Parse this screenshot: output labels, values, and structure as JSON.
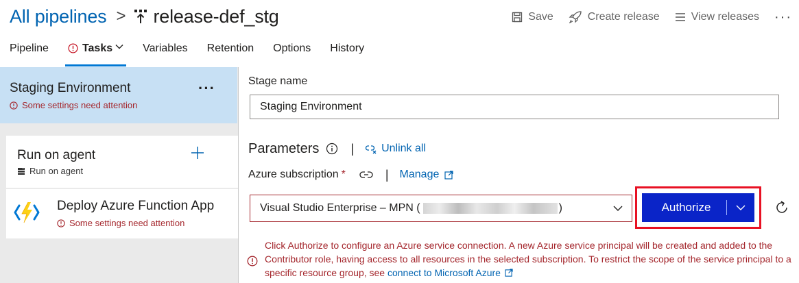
{
  "header": {
    "breadcrumb_root": "All pipelines",
    "breadcrumb_sep": ">",
    "pipeline_icon": "release-pipeline-icon",
    "pipeline_name": "release-def_stg",
    "commands": {
      "save": "Save",
      "create_release": "Create release",
      "view_releases": "View releases",
      "more": "···"
    }
  },
  "tabs": [
    {
      "label": "Pipeline"
    },
    {
      "label": "Tasks",
      "active": true,
      "warning": true
    },
    {
      "label": "Variables"
    },
    {
      "label": "Retention"
    },
    {
      "label": "Options"
    },
    {
      "label": "History"
    }
  ],
  "left": {
    "stage": {
      "title": "Staging Environment",
      "warning": "Some settings need attention",
      "more": "···"
    },
    "agent": {
      "title": "Run on agent",
      "subtitle": "Run on agent"
    },
    "task": {
      "title": "Deploy Azure Function App",
      "warning": "Some settings need attention"
    }
  },
  "right": {
    "stage_label": "Stage name",
    "stage_value": "Staging Environment",
    "parameters_title": "Parameters",
    "unlink_all": "Unlink all",
    "subscription_label": "Azure subscription",
    "required_mark": "*",
    "manage": "Manage",
    "subscription_value": "Visual Studio Enterprise – MPN (",
    "subscription_value_end": ")",
    "authorize": "Authorize",
    "error_text": "Click Authorize to configure an Azure service connection. A new Azure service principal will be created and added to the Contributor role, having access to all resources in the selected subscription. To restrict the scope of the service principal to a specific resource group, see",
    "error_link": "connect to Microsoft Azure"
  },
  "colors": {
    "accent": "#0078d4",
    "link": "#0063b1",
    "error": "#a4262c",
    "selected_stage": "#c7e0f4",
    "authorize_button": "#0a24c8",
    "highlight_box": "#e81123"
  }
}
